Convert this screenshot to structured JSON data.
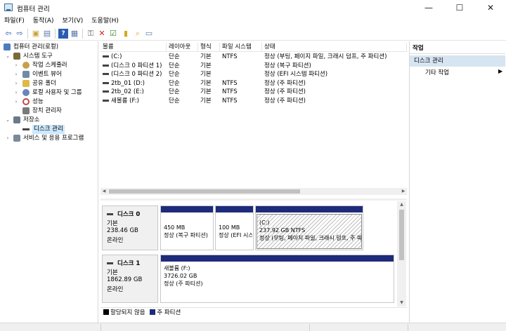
{
  "window": {
    "title": "컴퓨터 관리",
    "min": "—",
    "max": "☐",
    "close": "✕"
  },
  "menu": [
    "파일(F)",
    "동작(A)",
    "보기(V)",
    "도움말(H)"
  ],
  "toolbar": {
    "icons": [
      "back-arrow-icon",
      "forward-arrow-icon",
      "up-folder-icon",
      "show-tree-icon",
      "help-icon",
      "properties-icon",
      "connect-icon",
      "delete-icon",
      "check-icon",
      "import-icon",
      "search-icon",
      "view-icon"
    ]
  },
  "tree": {
    "items": [
      {
        "label": "컴퓨터 관리(로컬)",
        "indent": 0,
        "expander": "",
        "icon": "computer-management-icon",
        "color": "#4a7ebb"
      },
      {
        "label": "시스템 도구",
        "indent": 1,
        "expander": "⌄",
        "icon": "tools-icon",
        "color": "#7a6a3a"
      },
      {
        "label": "작업 스케줄러",
        "indent": 2,
        "expander": "›",
        "icon": "scheduler-icon",
        "color": "#c8a04a"
      },
      {
        "label": "이벤트 뷰어",
        "indent": 2,
        "expander": "›",
        "icon": "event-viewer-icon",
        "color": "#6d8ba8"
      },
      {
        "label": "공유 폴더",
        "indent": 2,
        "expander": "›",
        "icon": "shared-folder-icon",
        "color": "#e0b84a"
      },
      {
        "label": "로컬 사용자 및 그룹",
        "indent": 2,
        "expander": "›",
        "icon": "users-icon",
        "color": "#6a86b8"
      },
      {
        "label": "성능",
        "indent": 2,
        "expander": "›",
        "icon": "performance-icon",
        "color": "#c04a4a"
      },
      {
        "label": "장치 관리자",
        "indent": 2,
        "expander": "",
        "icon": "device-manager-icon",
        "color": "#7a7a7a"
      },
      {
        "label": "저장소",
        "indent": 1,
        "expander": "⌄",
        "icon": "storage-icon",
        "color": "#6a7a8a"
      },
      {
        "label": "디스크 관리",
        "indent": 2,
        "expander": "",
        "icon": "disk-management-icon",
        "color": "#444444",
        "selected": true
      },
      {
        "label": "서비스 및 응용 프로그램",
        "indent": 1,
        "expander": "›",
        "icon": "services-icon",
        "color": "#7a8a9a"
      }
    ]
  },
  "volume_list": {
    "columns": [
      "볼륨",
      "레이아웃",
      "형식",
      "파일 시스템",
      "상태"
    ],
    "rows": [
      [
        "(C:)",
        "단순",
        "기본",
        "NTFS",
        "정상 (부팅, 페이지 파일, 크래시 덤프, 주 파티션)"
      ],
      [
        "(디스크 0 파티션 1)",
        "단순",
        "기본",
        "",
        "정상 (복구 파티션)"
      ],
      [
        "(디스크 0 파티션 2)",
        "단순",
        "기본",
        "",
        "정상 (EFI 시스템 파티션)"
      ],
      [
        "2tb_01 (D:)",
        "단순",
        "기본",
        "NTFS",
        "정상 (주 파티션)"
      ],
      [
        "2tb_02 (E:)",
        "단순",
        "기본",
        "NTFS",
        "정상 (주 파티션)"
      ],
      [
        "새볼륨 (F:)",
        "단순",
        "기본",
        "NTFS",
        "정상 (주 파티션)"
      ]
    ]
  },
  "disks": [
    {
      "name": "디스크 0",
      "type": "기본",
      "size": "238.46 GB",
      "status": "온라인",
      "partitions": [
        {
          "name": "",
          "size": "450 MB",
          "status": "정상 (복구 파티션)"
        },
        {
          "name": "",
          "size": "100 MB",
          "status": "정상 (EFI 시스템 파티션)"
        },
        {
          "name": "(C:)",
          "size": "237.92 GB NTFS",
          "status": "정상 (부팅, 페이지 파일, 크래시 덤프, 주 파티션)"
        }
      ]
    },
    {
      "name": "디스크 1",
      "type": "기본",
      "size": "1862.89 GB",
      "status": "온라인",
      "partitions": [
        {
          "name": "새볼륨 (F:)",
          "size": "3726.02 GB",
          "status": "정상 (주 파티션)"
        }
      ]
    }
  ],
  "legend": [
    {
      "label": "할당되지 않음",
      "color": "#000000"
    },
    {
      "label": "주 파티션",
      "color": "#1e2a7a"
    }
  ],
  "actions": {
    "header": "작업",
    "section": "디스크 관리",
    "more": "기타 작업",
    "arrow": "▶"
  }
}
